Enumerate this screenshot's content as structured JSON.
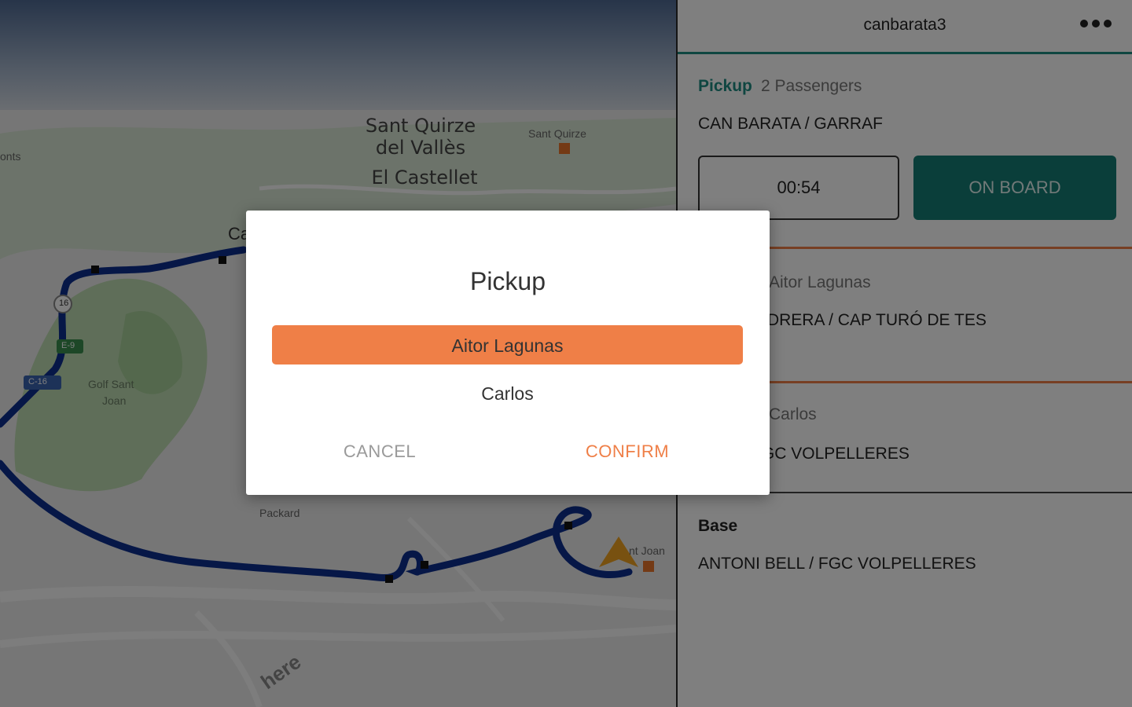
{
  "map": {
    "places": {
      "sant_quirze_line1": "Sant Quirze",
      "sant_quirze_line2": "del Vallès",
      "el_castellet": "El Castellet",
      "sant_quirze_small": "Sant Quirze",
      "golf_line1": "Golf Sant",
      "golf_line2": "Joan",
      "packard": "Packard",
      "ponts": "onts",
      "road_16": "16",
      "road_e9": "E-9",
      "road_c16": "C-16",
      "ca_label": "Ca",
      "sant_joan_small": "nt Joan",
      "brand": "here"
    },
    "colors": {
      "route": "#0d2f8f",
      "vehicle": "#f0a321",
      "station": "#e8742b"
    }
  },
  "panel": {
    "title": "canbarata3",
    "more_icon": "more-horizontal-icon",
    "current_stop": {
      "type": "Pickup",
      "passengers": "2 Passengers",
      "address": "CAN BARATA / GARRAF",
      "timer": "00:54",
      "on_board_label": "ON BOARD"
    },
    "stops": [
      {
        "name": "Aitor Lagunas",
        "address": "E VALLVIDRERA / CAP TURÓ DE TES"
      },
      {
        "name": "Carlos",
        "address": "BELL / FGC VOLPELLERES"
      }
    ],
    "base": {
      "title": "Base",
      "address": "ANTONI BELL / FGC VOLPELLERES"
    },
    "colors": {
      "teal": "#1e8c82",
      "orange": "#ef7f47"
    }
  },
  "dialog": {
    "title": "Pickup",
    "options": [
      "Aitor Lagunas",
      "Carlos"
    ],
    "selected_option": "Aitor Lagunas",
    "cancel_label": "CANCEL",
    "confirm_label": "CONFIRM"
  }
}
